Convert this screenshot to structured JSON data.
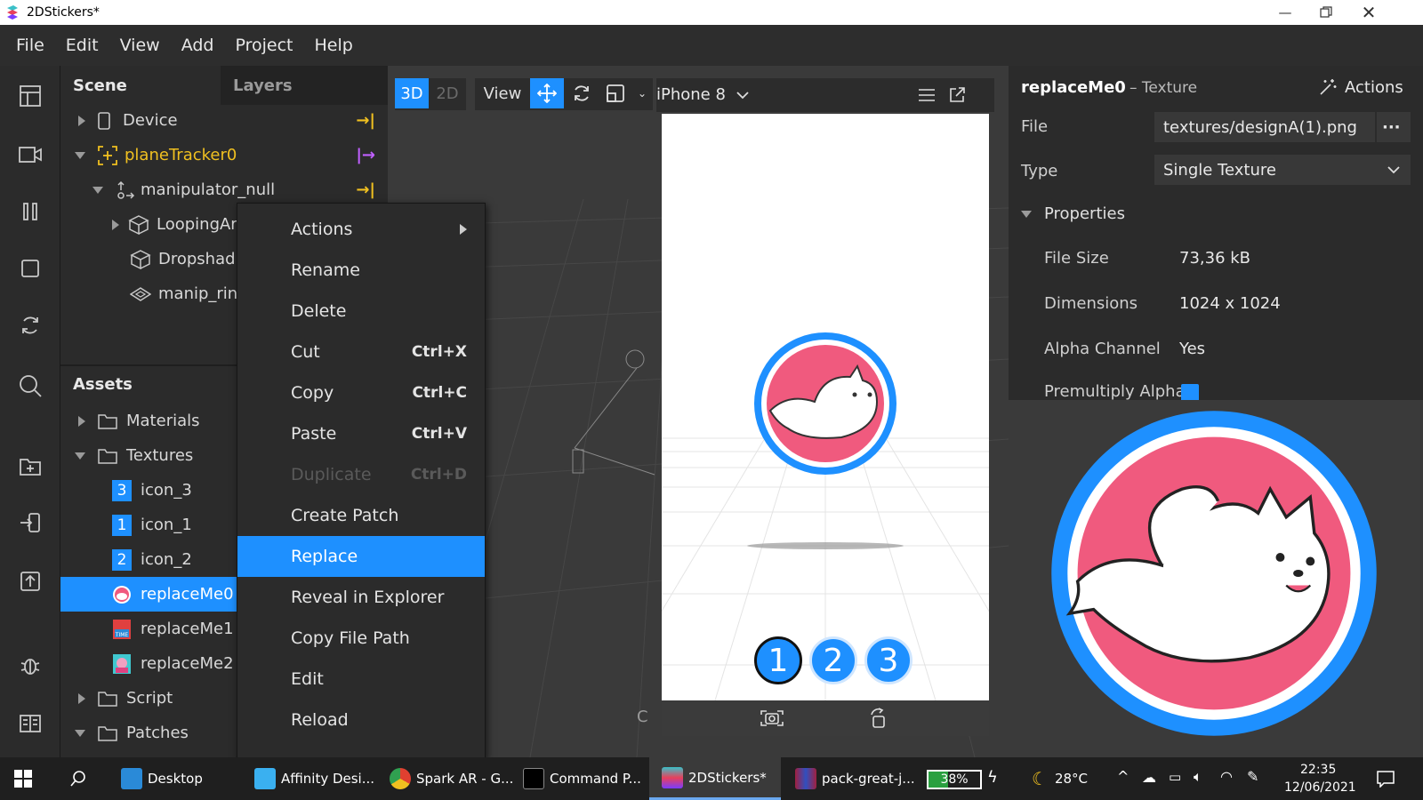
{
  "window": {
    "title": "2DStickers*"
  },
  "menubar": {
    "items": [
      "File",
      "Edit",
      "View",
      "Add",
      "Project",
      "Help"
    ]
  },
  "scene": {
    "tab_scene": "Scene",
    "tab_layers": "Layers",
    "rows": [
      "Device",
      "planeTracker0",
      "manipulator_null",
      "LoopingAr",
      "Dropshad",
      "manip_ring"
    ]
  },
  "assets": {
    "header": "Assets",
    "rows": [
      "Materials",
      "Textures",
      "icon_3",
      "icon_1",
      "icon_2",
      "replaceMe0",
      "replaceMe1",
      "replaceMe2",
      "Script",
      "Patches"
    ],
    "badges": [
      "3",
      "1",
      "2"
    ]
  },
  "viewport": {
    "btn_3d": "3D",
    "btn_2d": "2D",
    "btn_view": "View",
    "device": "iPhone 8",
    "stickers": [
      "1",
      "2",
      "3"
    ],
    "stray_letter": "C"
  },
  "context_menu": {
    "items": [
      {
        "label": "Actions",
        "shortcut": ""
      },
      {
        "label": "Rename",
        "shortcut": ""
      },
      {
        "label": "Delete",
        "shortcut": ""
      },
      {
        "label": "Cut",
        "shortcut": "Ctrl+X"
      },
      {
        "label": "Copy",
        "shortcut": "Ctrl+C"
      },
      {
        "label": "Paste",
        "shortcut": "Ctrl+V"
      },
      {
        "label": "Duplicate",
        "shortcut": "Ctrl+D"
      },
      {
        "label": "Create Patch",
        "shortcut": ""
      },
      {
        "label": "Replace",
        "shortcut": ""
      },
      {
        "label": "Reveal in Explorer",
        "shortcut": ""
      },
      {
        "label": "Copy File Path",
        "shortcut": ""
      },
      {
        "label": "Edit",
        "shortcut": ""
      },
      {
        "label": "Reload",
        "shortcut": ""
      }
    ],
    "highlighted": "Replace",
    "disabled": "Duplicate"
  },
  "inspector": {
    "name": "replaceMe0",
    "kind": "– Texture",
    "actions": "Actions",
    "file_label": "File",
    "file_value": "textures/designA(1).png",
    "file_more": "···",
    "type_label": "Type",
    "type_value": "Single Texture",
    "properties": "Properties",
    "file_size_label": "File Size",
    "file_size_value": "73,36 kB",
    "dimensions_label": "Dimensions",
    "dimensions_value": "1024 x 1024",
    "alpha_label": "Alpha Channel",
    "alpha_value": "Yes",
    "premultiply_label": "Premultiply Alpha"
  },
  "taskbar": {
    "items": [
      "Desktop",
      "Affinity Desi...",
      "Spark AR - G...",
      "Command P...",
      "2DStickers*",
      "pack-great-j..."
    ],
    "battery": "38%",
    "weather": "28°C",
    "time": "22:35",
    "date": "12/06/2021"
  },
  "colors": {
    "accent": "#1e90ff",
    "sticker_pink": "#f05a7e",
    "sticker_blue": "#1e90ff",
    "tracker_yellow": "#f0c020",
    "tracker_purple": "#c060ff"
  }
}
